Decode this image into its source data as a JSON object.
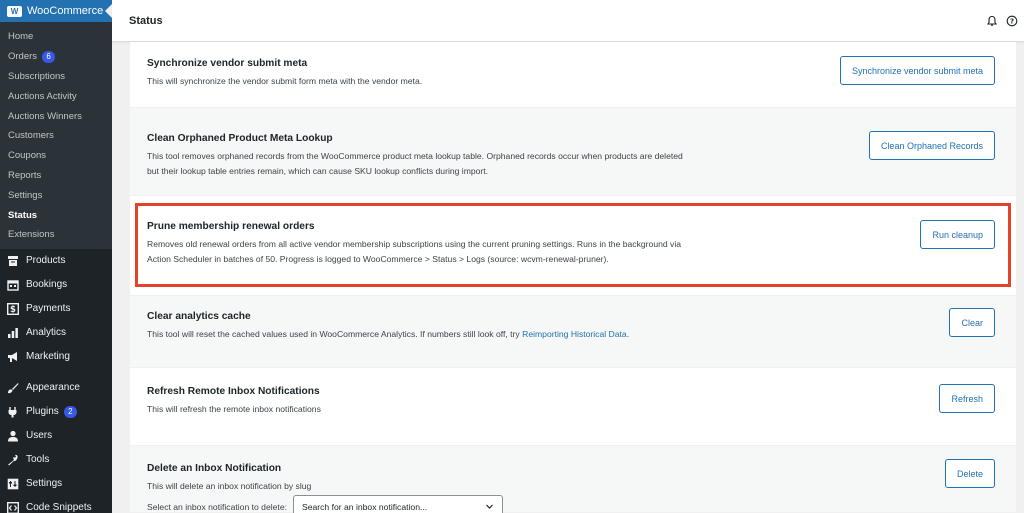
{
  "sidebar": {
    "brand": "WooCommerce",
    "submenu": [
      {
        "label": "Home"
      },
      {
        "label": "Orders",
        "badge": "6"
      },
      {
        "label": "Subscriptions"
      },
      {
        "label": "Auctions Activity"
      },
      {
        "label": "Auctions Winners"
      },
      {
        "label": "Customers"
      },
      {
        "label": "Coupons"
      },
      {
        "label": "Reports"
      },
      {
        "label": "Settings"
      },
      {
        "label": "Status"
      },
      {
        "label": "Extensions"
      }
    ],
    "menu": [
      {
        "label": "Products",
        "icon": "archive-icon"
      },
      {
        "label": "Bookings",
        "icon": "calendar-icon"
      },
      {
        "label": "Payments",
        "icon": "dollar-icon"
      },
      {
        "label": "Analytics",
        "icon": "bar-chart-icon"
      },
      {
        "label": "Marketing",
        "icon": "megaphone-icon"
      },
      {
        "label": "Appearance",
        "icon": "brush-icon"
      },
      {
        "label": "Plugins",
        "icon": "plug-icon",
        "badge": "2"
      },
      {
        "label": "Users",
        "icon": "user-icon"
      },
      {
        "label": "Tools",
        "icon": "wrench-icon"
      },
      {
        "label": "Settings",
        "icon": "sliders-icon"
      },
      {
        "label": "Code Snippets",
        "icon": "code-icon"
      }
    ]
  },
  "header": {
    "title": "Status"
  },
  "tools": [
    {
      "title": "Synchronize vendor submit meta",
      "description": "This will synchronize the vendor submit form meta with the vendor meta.",
      "button": "Synchronize vendor submit meta"
    },
    {
      "title": "Clean Orphaned Product Meta Lookup",
      "description_line1": "This tool removes orphaned records from the WooCommerce product meta lookup table. Orphaned records occur when products are deleted",
      "description_line2": "but their lookup table entries remain, which can cause SKU lookup conflicts during import.",
      "button": "Clean Orphaned Records"
    },
    {
      "title": "Prune membership renewal orders",
      "description_line1": "Removes old renewal orders from all active vendor membership subscriptions using the current pruning settings. Runs in the background via",
      "description_line2": "Action Scheduler in batches of 50. Progress is logged to WooCommerce > Status > Logs (source: wcvm-renewal-pruner).",
      "button": "Run cleanup"
    },
    {
      "title": "Clear analytics cache",
      "description": "This tool will reset the cached values used in WooCommerce Analytics. If numbers still look off, try ",
      "link": "Reimporting Historical Data",
      "description_end": ".",
      "button": "Clear"
    },
    {
      "title": "Refresh Remote Inbox Notifications",
      "description": "This will refresh the remote inbox notifications",
      "button": "Refresh"
    },
    {
      "title": "Delete an Inbox Notification",
      "description": "This will delete an inbox notification by slug",
      "select_label": "Select an inbox notification to delete:",
      "select_placeholder": "Search for an inbox notification...",
      "button": "Delete"
    }
  ],
  "colors": {
    "accent": "#2271b1",
    "highlight": "#e2442a",
    "sidebar": "#1d2327"
  }
}
